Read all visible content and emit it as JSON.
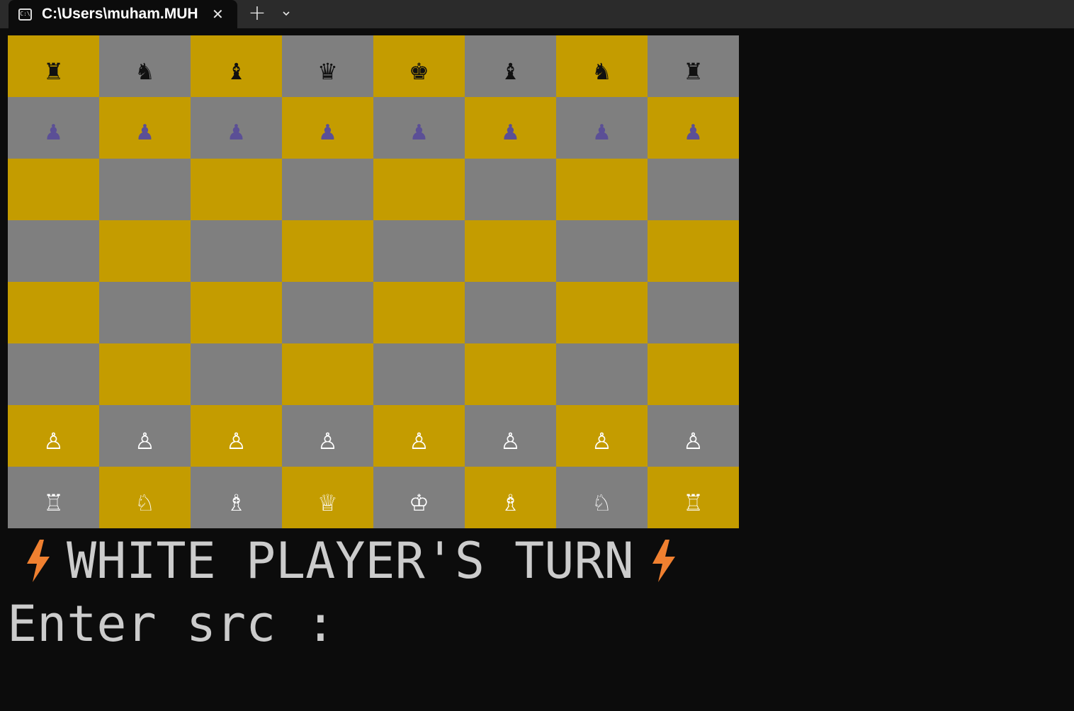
{
  "window": {
    "tab_title": "C:\\Users\\muham.MUH",
    "tab_icon": "terminal-icon",
    "tab_icon_text": "C:\\",
    "close_glyph": "✕",
    "new_tab_glyph": "+",
    "dropdown_icon": "chevron-down-icon"
  },
  "board": {
    "colors": {
      "light": "#c49c00",
      "dark": "#7f7f7f",
      "black_piece": "#111111",
      "black_pawn": "#5b4f96",
      "white_piece": "#ffffff"
    },
    "ranks": [
      [
        "♜",
        "♞",
        "♝",
        "♛",
        "♚",
        "♝",
        "♞",
        "♜"
      ],
      [
        "♟",
        "♟",
        "♟",
        "♟",
        "♟",
        "♟",
        "♟",
        "♟"
      ],
      [
        "",
        "",
        "",
        "",
        "",
        "",
        "",
        ""
      ],
      [
        "",
        "",
        "",
        "",
        "",
        "",
        "",
        ""
      ],
      [
        "",
        "",
        "",
        "",
        "",
        "",
        "",
        ""
      ],
      [
        "",
        "",
        "",
        "",
        "",
        "",
        "",
        ""
      ],
      [
        "♙",
        "♙",
        "♙",
        "♙",
        "♙",
        "♙",
        "♙",
        "♙"
      ],
      [
        "♖",
        "♘",
        "♗",
        "♕",
        "♔",
        "♗",
        "♘",
        "♖"
      ]
    ]
  },
  "status": {
    "turn_text": "WHITE PLAYER'S TURN",
    "bolt_icon": "lightning-bolt-icon",
    "bolt_color": "#f08030"
  },
  "prompt": {
    "text": "Enter src : "
  }
}
